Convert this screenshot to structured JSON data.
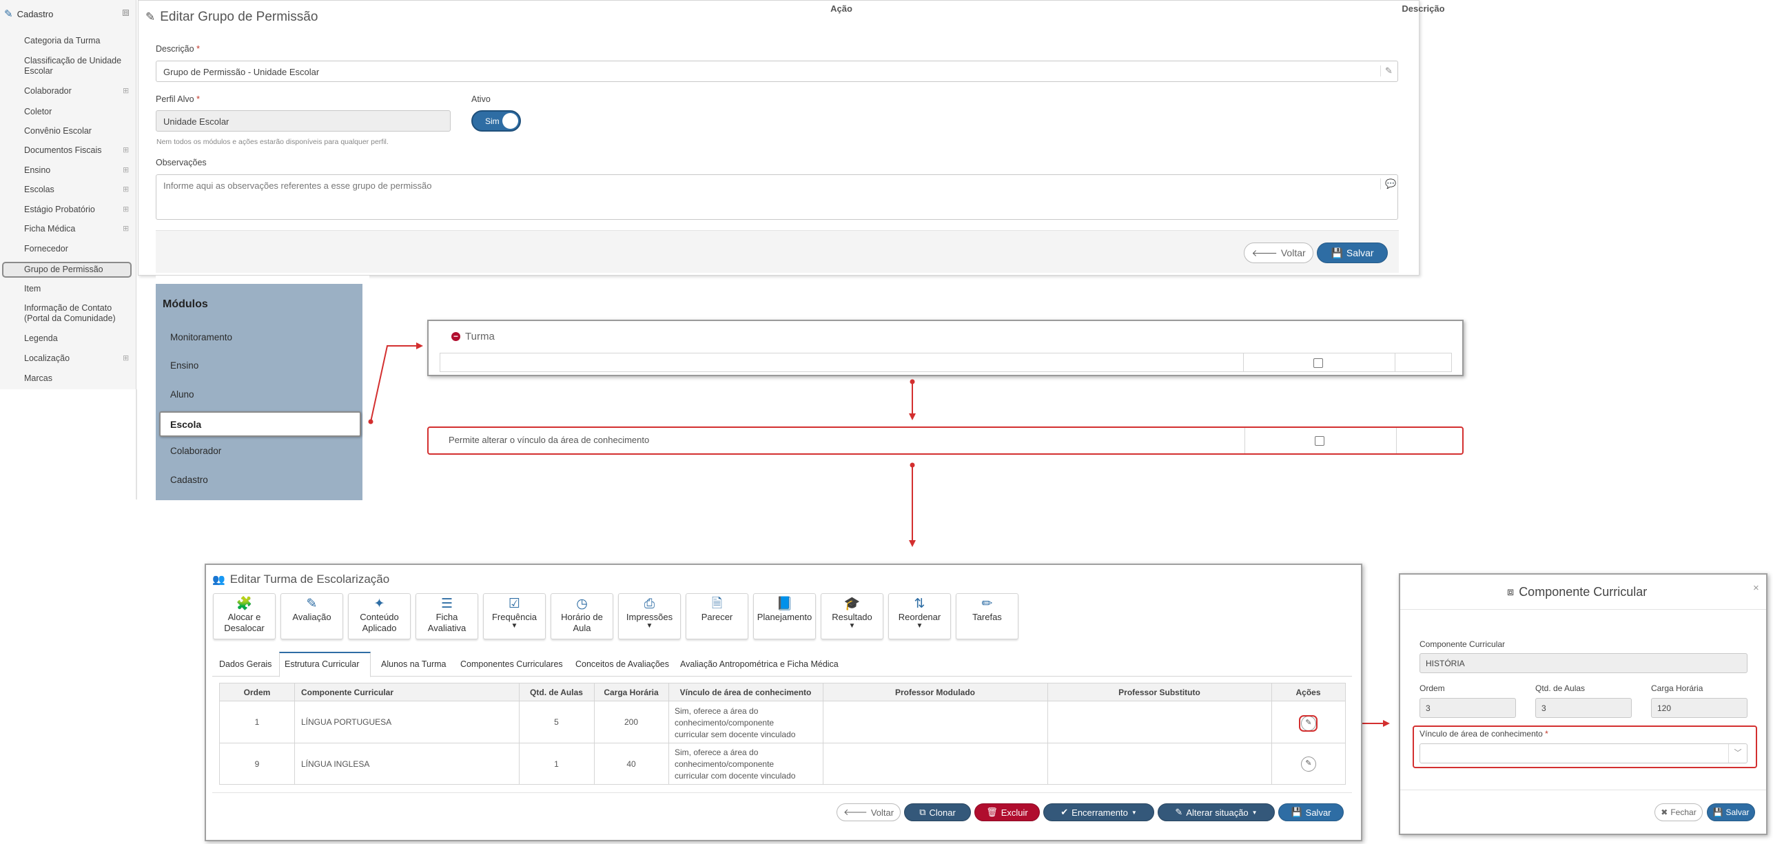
{
  "sidebar": {
    "header": "Cadastro",
    "collapse_glyph": "⊟",
    "expand_glyph": "⊞",
    "items": [
      {
        "label": "Categoria da Turma"
      },
      {
        "label": "Classificação de Unidade Escolar"
      },
      {
        "label": "Colaborador"
      },
      {
        "label": "Coletor"
      },
      {
        "label": "Convênio Escolar"
      },
      {
        "label": "Documentos Fiscais"
      },
      {
        "label": "Ensino"
      },
      {
        "label": "Escolas"
      },
      {
        "label": "Estágio Probatório"
      },
      {
        "label": "Ficha Médica"
      },
      {
        "label": "Fornecedor"
      },
      {
        "label": "Grupo de Permissão"
      },
      {
        "label": "Item"
      },
      {
        "label": "Informação de Contato (Portal da Comunidade)"
      },
      {
        "label": "Legenda"
      },
      {
        "label": "Localização"
      },
      {
        "label": "Marcas"
      }
    ]
  },
  "permission_form": {
    "title": "Editar Grupo de Permissão",
    "description_label": "Descrição",
    "required_mark": "*",
    "description_value": "Grupo de Permissão - Unidade Escolar",
    "profile_label": "Perfil Alvo",
    "profile_value": "Unidade Escolar",
    "profile_hint": "Nem todos os módulos e ações estarão disponíveis para qualquer perfil.",
    "active_label": "Ativo",
    "active_value": "Sim",
    "notes_label": "Observações",
    "notes_placeholder": "Informe aqui as observações referentes a esse grupo de permissão",
    "back_label": "Voltar",
    "save_label": "Salvar"
  },
  "modules": {
    "title": "Módulos",
    "items": [
      "Monitoramento",
      "Ensino",
      "Aluno",
      "Escola",
      "Colaborador",
      "Cadastro"
    ],
    "active": "Escola"
  },
  "turma_table": {
    "title": "Turma",
    "col_action": "Ação",
    "col_description": "Descrição"
  },
  "permission_row": {
    "text": "Permite alterar o vínculo da área de conhecimento"
  },
  "class_form": {
    "title": "Editar Turma de Escolarização",
    "toolbar": [
      {
        "label": "Alocar e Desalocar",
        "icon": "puzzle-icon"
      },
      {
        "label": "Avaliação",
        "icon": "edit-icon"
      },
      {
        "label": "Conteúdo Aplicado",
        "icon": "magic-wand-icon"
      },
      {
        "label": "Ficha Avaliativa",
        "icon": "list-icon"
      },
      {
        "label": "Frequência",
        "icon": "checkbox-icon"
      },
      {
        "label": "Horário de Aula",
        "icon": "clock-icon"
      },
      {
        "label": "Impressões",
        "icon": "printer-icon"
      },
      {
        "label": "Parecer",
        "icon": "document-icon"
      },
      {
        "label": "Planejamento",
        "icon": "book-icon"
      },
      {
        "label": "Resultado",
        "icon": "graduation-cap-icon"
      },
      {
        "label": "Reordenar",
        "icon": "sort-alpha-icon"
      },
      {
        "label": "Tarefas",
        "icon": "pencil-icon"
      }
    ],
    "tabs": [
      "Dados Gerais",
      "Estrutura Curricular",
      "Alunos na Turma",
      "Componentes Curriculares",
      "Conceitos de Avaliações",
      "Avaliação Antropométrica e Ficha Médica"
    ],
    "active_tab": "Estrutura Curricular",
    "columns": [
      "Ordem",
      "Componente Curricular",
      "Qtd. de Aulas",
      "Carga Horária",
      "Vínculo de área de conhecimento",
      "Professor Modulado",
      "Professor Substituto",
      "Ações"
    ],
    "rows": [
      {
        "order": "1",
        "component": "LÍNGUA PORTUGUESA",
        "classes": "5",
        "hours": "200",
        "link_l1": "Sim, oferece a área do",
        "link_l2": "conhecimento/componente",
        "link_l3": "curricular sem docente vinculado"
      },
      {
        "order": "9",
        "component": "LÍNGUA INGLESA",
        "classes": "1",
        "hours": "40",
        "link_l1": "Sim, oferece a área do",
        "link_l2": "conhecimento/componente",
        "link_l3": "curricular com docente vinculado"
      }
    ],
    "buttons": {
      "back": "Voltar",
      "clone": "Clonar",
      "delete": "Excluir",
      "closing": "Encerramento",
      "change_status": "Alterar situação",
      "save": "Salvar"
    }
  },
  "modal": {
    "title": "Componente Curricular",
    "component_label": "Componente Curricular",
    "component_value": "HISTÓRIA",
    "order_label": "Ordem",
    "order_value": "3",
    "classes_label": "Qtd. de Aulas",
    "classes_value": "3",
    "hours_label": "Carga Horária",
    "hours_value": "120",
    "link_label": "Vínculo de área de conhecimento",
    "close_label": "Fechar",
    "save_label": "Salvar"
  },
  "colors": {
    "primary": "#2e6da4",
    "dark": "#34587a",
    "danger": "#b00d2e",
    "highlight": "#d32f2f",
    "modules_bg": "#9bb0c4"
  }
}
